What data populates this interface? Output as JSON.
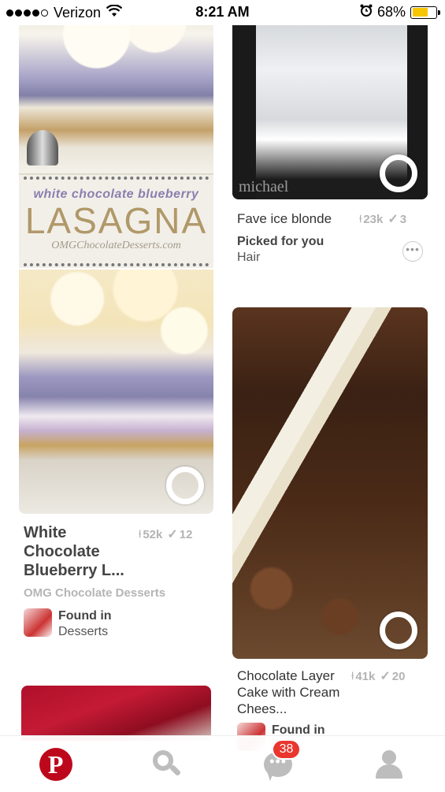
{
  "status_bar": {
    "carrier": "Verizon",
    "time": "8:21 AM",
    "battery_percent": "68%",
    "battery_level": 0.68,
    "signal_bars": 4,
    "icons": [
      "wifi-icon",
      "alarm-icon",
      "battery-icon"
    ]
  },
  "pins": [
    {
      "image_text_small": "white chocolate blueberry",
      "image_text_big": "LASAGNA",
      "image_text_site": "OMGChocolateDesserts.com",
      "title": "White Chocolate Blueberry L...",
      "saves": "52k",
      "tries": "12",
      "source": "OMG Chocolate Desserts",
      "found_label": "Found in",
      "found_board": "Desserts"
    },
    {
      "image_watermark": "michael",
      "title": "Fave ice blonde",
      "saves": "23k",
      "tries": "3",
      "picked_label": "Picked for you",
      "picked_topic": "Hair"
    },
    {
      "title": "Chocolate Layer Cake with Cream Chees...",
      "saves": "41k",
      "tries": "20",
      "found_label": "Found in"
    }
  ],
  "tab_bar": {
    "items": [
      "pinterest-home",
      "search",
      "messages",
      "profile"
    ],
    "notifications_badge": "38",
    "accent_color": "#bd081c"
  }
}
